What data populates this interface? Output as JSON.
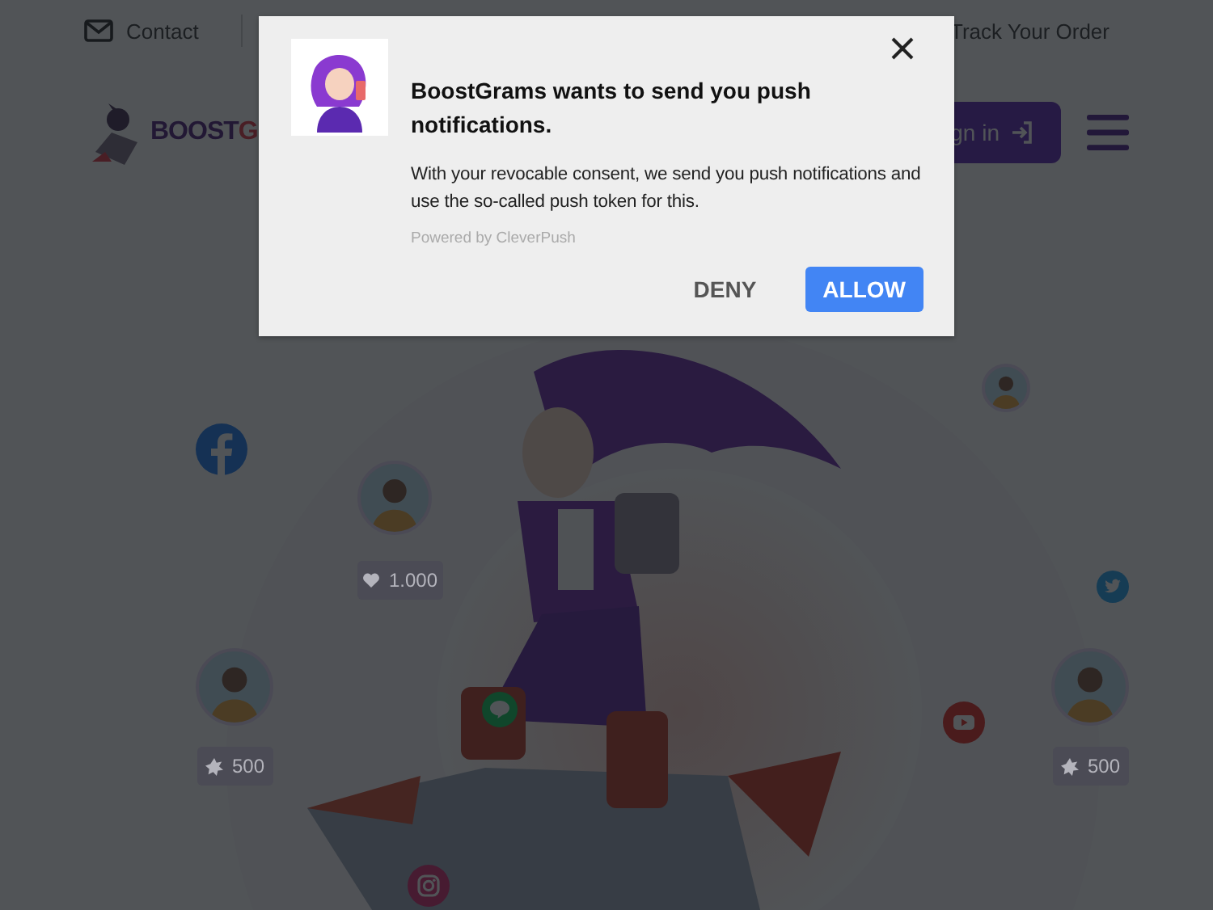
{
  "top_bar": {
    "contact": "Contact",
    "track_order": "Track Your Order"
  },
  "logo": {
    "parts": [
      {
        "text": "BOOST",
        "kind": "primary"
      },
      {
        "text": "G",
        "kind": "accent"
      }
    ]
  },
  "sign_in": {
    "label": "gn in"
  },
  "hero": {
    "kind": "picture",
    "socials": [
      {
        "kind": "facebook"
      },
      {
        "kind": "twitter"
      },
      {
        "kind": "youtube"
      },
      {
        "kind": "line"
      },
      {
        "kind": "instagram"
      }
    ],
    "avatars": [
      {
        "kind": "avatar"
      },
      {
        "kind": "avatar"
      },
      {
        "kind": "avatar"
      },
      {
        "kind": "avatar"
      }
    ],
    "stats": [
      {
        "kind": "heart",
        "value": "1.000"
      },
      {
        "kind": "burst",
        "value": "500"
      },
      {
        "kind": "burst",
        "value": "500"
      }
    ]
  },
  "dialog": {
    "title": "BoostGrams wants to send you push notifications.",
    "body": "With your revocable consent, we send you push notifications and use the so-called push token for this.",
    "powered_by": "Powered by CleverPush",
    "buttons": [
      {
        "label": "DENY",
        "kind": "text"
      },
      {
        "label": "ALLOW",
        "kind": "primary"
      }
    ]
  }
}
